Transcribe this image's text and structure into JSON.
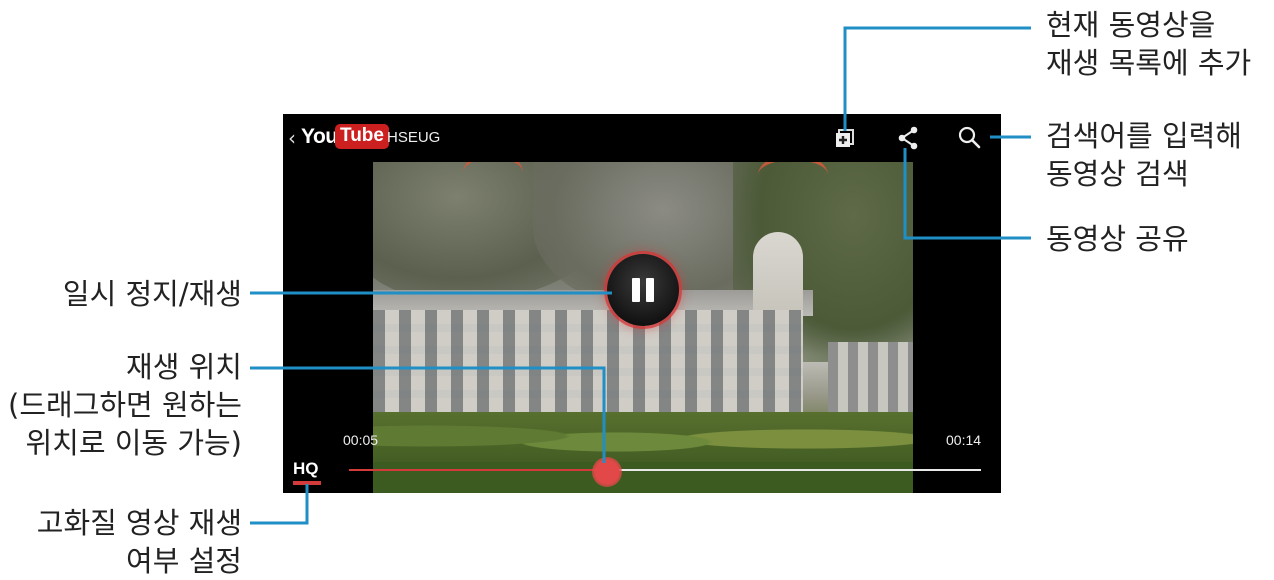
{
  "player": {
    "brand_you": "You",
    "brand_tube": "Tube",
    "channel": "HSEUG",
    "elapsed": "00:05",
    "duration": "00:14",
    "progress": 0.408,
    "hq_label": "HQ"
  },
  "icons": {
    "back": "chevron-left-icon",
    "add_playlist": "add-to-playlist-icon",
    "share": "share-icon",
    "search": "search-icon",
    "pause": "pause-icon"
  },
  "callouts": {
    "add_to_playlist": [
      "현재 동영상을",
      "재생 목록에 추가"
    ],
    "search": [
      "검색어를 입력해",
      "동영상 검색"
    ],
    "share": [
      "동영상 공유"
    ],
    "pause_play": [
      "일시 정지/재생"
    ],
    "position": [
      "재생 위치",
      "(드래그하면 원하는",
      "위치로 이동 가능)"
    ],
    "hq": [
      "고화질 영상 재생",
      "여부 설정"
    ]
  },
  "colors": {
    "accent": "#1f8fc6",
    "progress": "#d33b3b",
    "youtube_red": "#cc1f1f"
  }
}
